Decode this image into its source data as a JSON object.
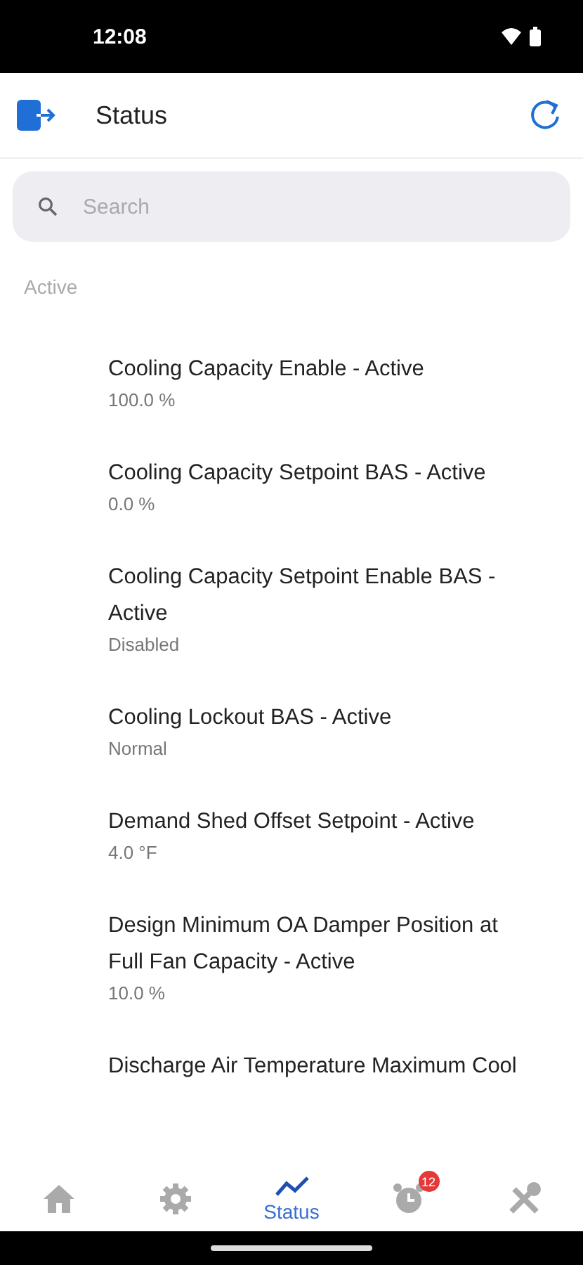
{
  "status_bar": {
    "time": "12:08"
  },
  "app_bar": {
    "title": "Status"
  },
  "search": {
    "placeholder": "Search"
  },
  "section": {
    "title": "Active"
  },
  "items": [
    {
      "title": "Cooling Capacity Enable - Active",
      "value": "100.0 %"
    },
    {
      "title": "Cooling Capacity Setpoint BAS - Active",
      "value": "0.0 %"
    },
    {
      "title": "Cooling Capacity Setpoint Enable BAS - Active",
      "value": "Disabled"
    },
    {
      "title": "Cooling Lockout BAS - Active",
      "value": "Normal"
    },
    {
      "title": "Demand Shed Offset Setpoint - Active",
      "value": "4.0 °F"
    },
    {
      "title": "Design Minimum OA Damper Position at Full Fan Capacity - Active",
      "value": "10.0 %"
    },
    {
      "title": "Discharge Air Temperature Maximum Cool"
    }
  ],
  "bottom_nav": [
    {
      "kind": "home",
      "selected": false
    },
    {
      "kind": "settings",
      "selected": false
    },
    {
      "kind": "status",
      "label": "Status",
      "selected": true
    },
    {
      "kind": "alarm",
      "badge": "12",
      "selected": false
    },
    {
      "kind": "tools",
      "selected": false
    }
  ]
}
